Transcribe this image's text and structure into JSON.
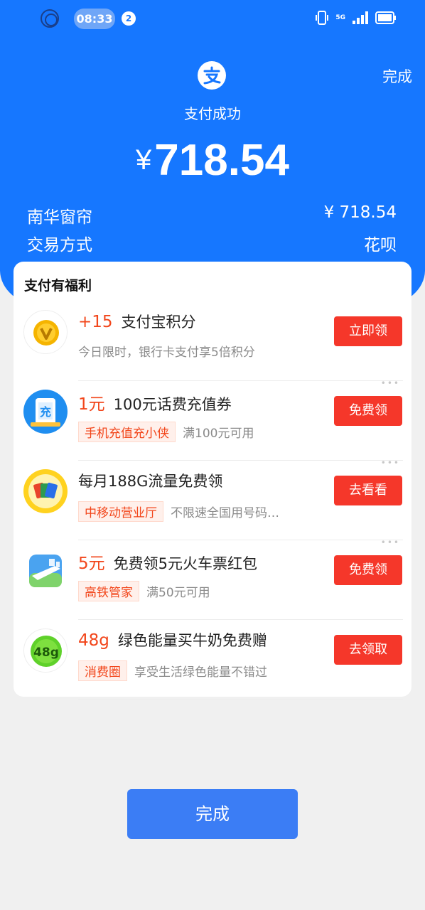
{
  "status_bar": {
    "time": "08:33",
    "notification_count": "2",
    "network": "5G"
  },
  "header": {
    "done_label": "完成",
    "title": "支付成功",
    "currency_symbol": "¥",
    "amount": "718.54",
    "merchant_label": "南华窗帘",
    "merchant_amount": "¥ 718.54",
    "method_label": "交易方式",
    "method_value": "花呗"
  },
  "benefits": {
    "title": "支付有福利",
    "items": [
      {
        "highlight": "+15",
        "title": "支付宝积分",
        "tag": "",
        "desc": "今日限时，银行卡支付享5倍积分",
        "button": "立即领",
        "icon": "alipay-points-icon"
      },
      {
        "highlight": "1元",
        "title": "100元话费充值券",
        "tag": "手机充值充小侠",
        "desc": "满100元可用",
        "button": "免费领",
        "icon": "phone-recharge-icon"
      },
      {
        "highlight": "",
        "title": "每月188G流量免费领",
        "tag": "中移动营业厅",
        "desc": "不限速全国用号码…",
        "button": "去看看",
        "icon": "sim-card-icon"
      },
      {
        "highlight": "5元",
        "title": "免费领5元火车票红包",
        "tag": "高铁管家",
        "desc": "满50元可用",
        "button": "免费领",
        "icon": "high-speed-train-icon"
      },
      {
        "highlight": "48g",
        "title": "绿色能量买牛奶免费赠",
        "tag": "消费圈",
        "desc": "享受生活绿色能量不错过",
        "button": "去领取",
        "icon": "green-energy-icon"
      }
    ]
  },
  "bottom": {
    "done_label": "完成"
  },
  "colors": {
    "brand_blue": "#1677ff",
    "button_red": "#f5372a",
    "highlight_red": "#f2461b",
    "done_blue": "#3b7df5"
  }
}
